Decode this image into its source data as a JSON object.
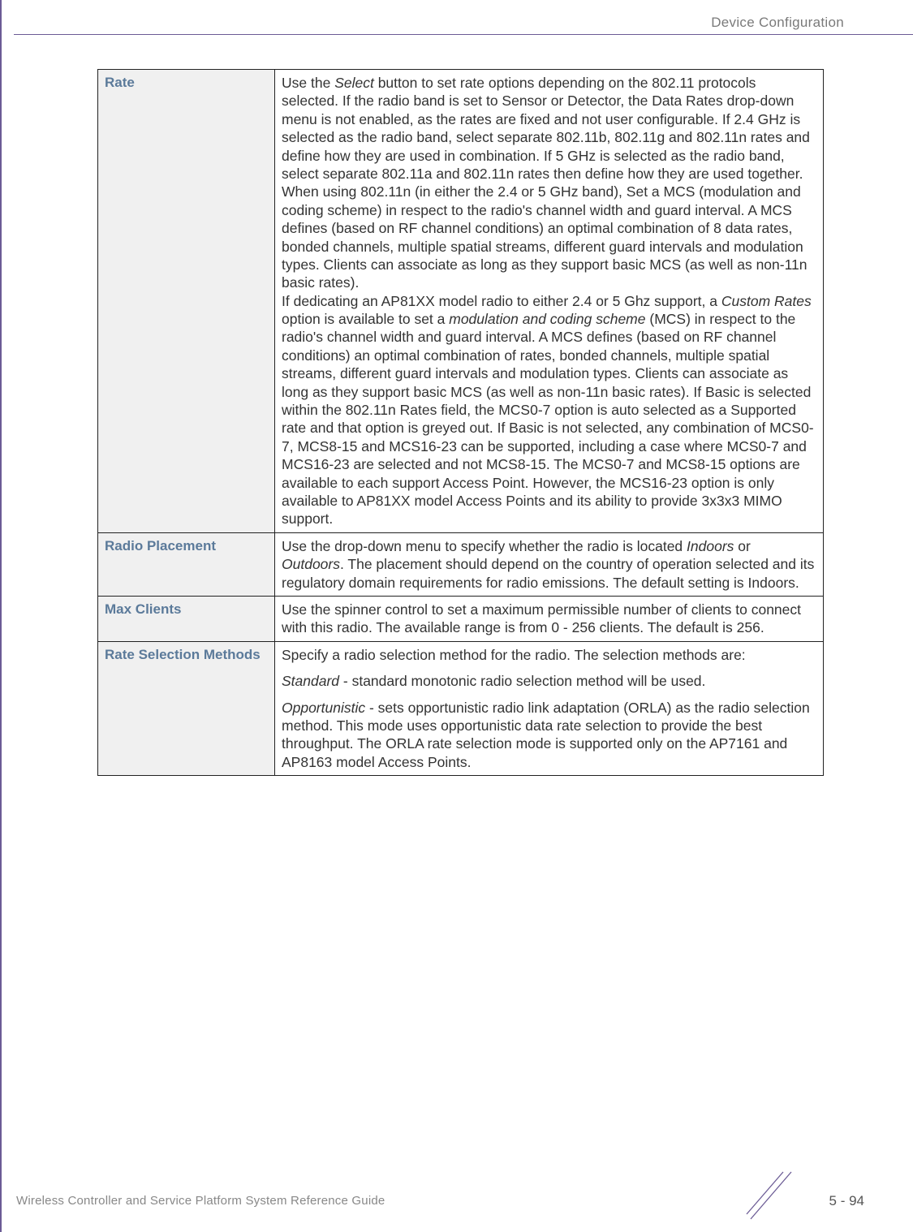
{
  "header": {
    "section": "Device Configuration"
  },
  "table": {
    "rows": [
      {
        "label": "Rate",
        "desc_parts": [
          {
            "t": "Use the "
          },
          {
            "t": "Select",
            "i": true
          },
          {
            "t": " button to set rate options depending on the 802.11 protocols selected. If the radio band is set to Sensor or Detector, the Data Rates drop-down menu is not enabled, as the rates are fixed and not user configurable. If 2.4 GHz is selected as the radio band, select separate 802.11b, 802.11g and 802.11n rates and define how they are used in combination. If 5 GHz is selected as the radio band, select separate 802.11a and 802.11n rates then define how they are used together. When using 802.11n (in either the 2.4 or 5 GHz band), Set a MCS (modulation and coding scheme) in respect to the radio's channel width and guard interval. A MCS defines (based on RF channel conditions) an optimal combination of 8 data rates, bonded channels, multiple spatial streams, different guard intervals and modulation types. Clients can associate as long as they support basic MCS (as well as non-11n basic rates)."
          },
          {
            "br": true
          },
          {
            "t": "If dedicating an AP81XX model radio to either 2.4 or 5 Ghz support, a "
          },
          {
            "t": "Custom Rates",
            "i": true
          },
          {
            "t": " option is available to set a "
          },
          {
            "t": "modulation and coding scheme",
            "i": true
          },
          {
            "t": " (MCS) in respect to the radio's channel width and guard interval. A MCS defines (based on RF channel conditions) an optimal combination of rates, bonded channels, multiple spatial streams, different guard intervals and modulation types. Clients can associate as long as they support basic MCS (as well as non-11n basic rates). If Basic is selected within the 802.11n Rates field, the MCS0-7 option is auto selected as a Supported rate and that option is greyed out. If Basic is not selected, any combination of MCS0-7, MCS8-15 and MCS16-23 can be supported, including a case where MCS0-7 and MCS16-23 are selected and not MCS8-15. The MCS0-7 and MCS8-15 options are available to each support Access Point. However, the MCS16-23 option is only available to AP81XX model Access Points and its ability to provide 3x3x3 MIMO support."
          }
        ]
      },
      {
        "label": "Radio Placement",
        "desc_parts": [
          {
            "t": "Use the drop-down menu to specify whether the radio is located "
          },
          {
            "t": "Indoors",
            "i": true
          },
          {
            "t": " or "
          },
          {
            "t": "Outdoors",
            "i": true
          },
          {
            "t": ". The placement should depend on the country of operation selected and its regulatory domain requirements for radio emissions. The default setting is Indoors."
          }
        ]
      },
      {
        "label": "Max Clients",
        "desc_parts": [
          {
            "t": "Use the spinner control to set a maximum permissible number of clients to connect with this radio. The available range is from 0 - 256 clients. The default is 256."
          }
        ]
      },
      {
        "label": "Rate Selection Methods",
        "desc_parts": [
          {
            "t": "Specify a radio selection method for the radio. The selection methods are:"
          },
          {
            "p": true
          },
          {
            "t": "Standard",
            "i": true
          },
          {
            "t": " - standard monotonic radio selection method will be used."
          },
          {
            "p": true
          },
          {
            "t": "Opportunistic",
            "i": true
          },
          {
            "t": " - sets opportunistic radio link adaptation (ORLA) as the radio selection method. This mode uses opportunistic data rate selection to provide the best throughput. The ORLA rate selection mode is supported only on the AP7161 and AP8163 model Access Points."
          }
        ]
      }
    ]
  },
  "footer": {
    "text": "Wireless Controller and Service Platform System Reference Guide",
    "page": "5 - 94"
  }
}
